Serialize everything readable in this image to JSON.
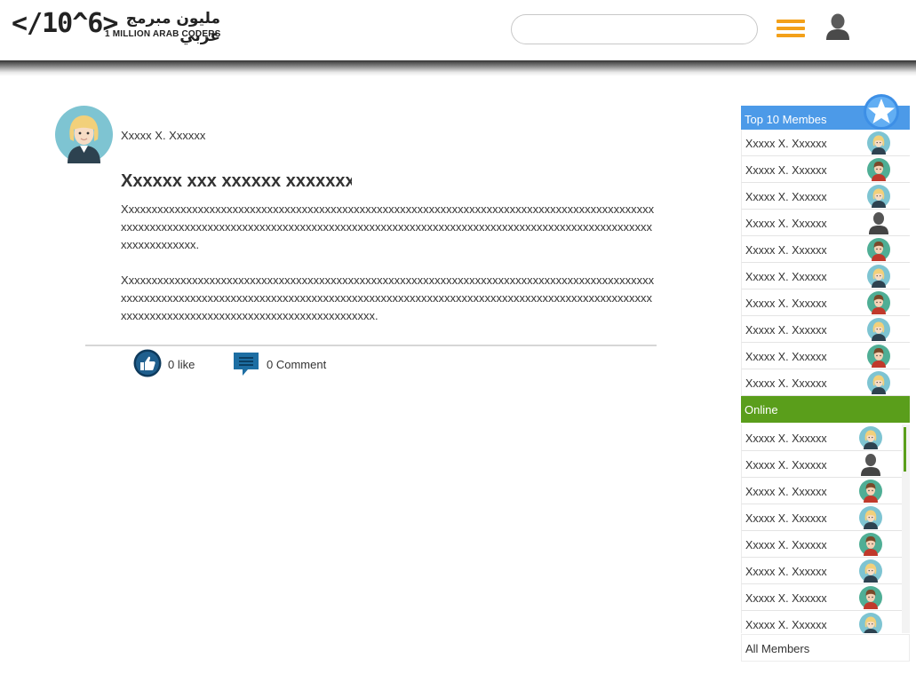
{
  "header": {
    "logo_mark": "</10^6>",
    "logo_arabic": "مليون مبرمج عربي",
    "logo_english": "1 MILLION ARAB CODERS",
    "search_value": "",
    "colors": {
      "menu_accent": "#f3a019"
    }
  },
  "post": {
    "author": "Xxxxx X. Xxxxxx",
    "title": "Xxxxxx xxx xxxxxx xxxxxxx",
    "paragraphs": [
      "Xxxxxxxxxxxxxxxxxxxxxxxxxxxxxxxxxxxxxxxxxxxxxxxxxxxxxxxxxxxxxxxxxxxxxxxxxxxxxxxxxxxxxxxxxxxxxxxxxxxxxxxxxxxxxxxxxxxxxxxxxxxxxxxxxxxxxxxxxxxxxxxxxxxxxxxxxxxxxxxxxxxxxxxxxxxxxxxxxxxxxxxxxxxxxxxxxxxxx.",
      "Xxxxxxxxxxxxxxxxxxxxxxxxxxxxxxxxxxxxxxxxxxxxxxxxxxxxxxxxxxxxxxxxxxxxxxxxxxxxxxxxxxxxxxxxxxxxxxxxxxxxxxxxxxxxxxxxxxxxxxxxxxxxxxxxxxxxxxxxxxxxxxxxxxxxxxxxxxxxxxxxxxxxxxxxxxxxxxxxxxxxxxxxxxxxxxxxxxxxxxxxxxxxxxxxxxxxxxxxxxxxxxxxxxxx."
    ],
    "like_label": "0 like",
    "comment_label": "0 Comment"
  },
  "sidebar": {
    "top10_title": "Top 10 Membes",
    "top10_color": "#4c9ae8",
    "online_title": "Online",
    "online_color": "#5a9e1b",
    "all_members_label": "All Members",
    "top10": [
      {
        "name": "Xxxxx X. Xxxxxx",
        "avatar": "female-avatar-icon"
      },
      {
        "name": "Xxxxx X. Xxxxxx",
        "avatar": "male-avatar-icon"
      },
      {
        "name": "Xxxxx X. Xxxxxx",
        "avatar": "female-avatar-icon"
      },
      {
        "name": "Xxxxx X. Xxxxxx",
        "avatar": "default-user-icon"
      },
      {
        "name": "Xxxxx X. Xxxxxx",
        "avatar": "male-avatar-icon"
      },
      {
        "name": "Xxxxx X. Xxxxxx",
        "avatar": "female-avatar-icon"
      },
      {
        "name": "Xxxxx X. Xxxxxx",
        "avatar": "male-avatar-icon"
      },
      {
        "name": "Xxxxx X. Xxxxxx",
        "avatar": "female-avatar-icon"
      },
      {
        "name": "Xxxxx X. Xxxxxx",
        "avatar": "male-avatar-icon"
      },
      {
        "name": "Xxxxx X. Xxxxxx",
        "avatar": "female-avatar-icon"
      }
    ],
    "online": [
      {
        "name": "Xxxxx X. Xxxxxx",
        "avatar": "female-avatar-icon"
      },
      {
        "name": "Xxxxx X. Xxxxxx",
        "avatar": "default-user-icon"
      },
      {
        "name": "Xxxxx X. Xxxxxx",
        "avatar": "male-avatar-icon"
      },
      {
        "name": "Xxxxx X. Xxxxxx",
        "avatar": "female-avatar-icon"
      },
      {
        "name": "Xxxxx X. Xxxxxx",
        "avatar": "male-avatar-icon"
      },
      {
        "name": "Xxxxx X. Xxxxxx",
        "avatar": "female-avatar-icon"
      },
      {
        "name": "Xxxxx X. Xxxxxx",
        "avatar": "male-avatar-icon"
      },
      {
        "name": "Xxxxx X. Xxxxxx",
        "avatar": "female-avatar-icon"
      }
    ]
  }
}
